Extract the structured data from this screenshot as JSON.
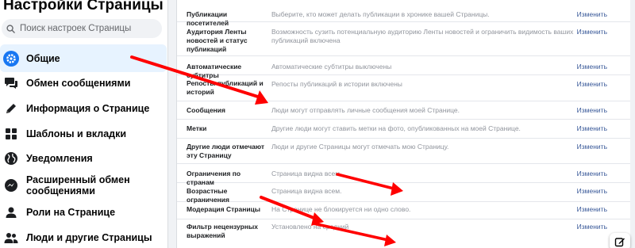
{
  "sidebar": {
    "title": "Настройки Страницы",
    "search_placeholder": "Поиск настроек Страницы",
    "items": [
      {
        "label": "Общие",
        "icon": "gear-icon",
        "active": true
      },
      {
        "label": "Обмен сообщениями",
        "icon": "chat-bubble-icon"
      },
      {
        "label": "Информация о Странице",
        "icon": "pencil-icon"
      },
      {
        "label": "Шаблоны и вкладки",
        "icon": "grid-icon"
      },
      {
        "label": "Уведомления",
        "icon": "globe-icon"
      },
      {
        "label": "Расширенный обмен сообщениями",
        "icon": "messenger-icon"
      },
      {
        "label": "Роли на Странице",
        "icon": "person-icon"
      },
      {
        "label": "Люди и другие Страницы",
        "icon": "people-icon"
      }
    ]
  },
  "settings": {
    "edit_label": "Изменить",
    "rows": [
      {
        "name": "Публикации посетителей",
        "desc": "Выберите, кто может делать публикации в хронике вашей Страницы."
      },
      {
        "name": "Аудитория Ленты новостей и статус публикаций",
        "desc": "Возможность сузить потенциальную аудиторию Ленты новостей и ограничить видимость ваших публикаций включена"
      },
      {
        "name": "Автоматические субтитры",
        "desc": "Автоматические субтитры выключены"
      },
      {
        "name": "Репосты публикаций и историй",
        "desc": "Репосты публикаций в истории включены"
      },
      {
        "name": "Сообщения",
        "desc": "Люди могут отправлять личные сообщения моей Странице."
      },
      {
        "name": "Метки",
        "desc": "Другие люди могут ставить метки на фото, опубликованных на моей Странице."
      },
      {
        "name": "Другие люди отмечают эту Страницу",
        "desc": "Люди и другие Страницы могут отмечать мою Страницу."
      },
      {
        "name": "Ограничения по странам",
        "desc": "Страница видна всем."
      },
      {
        "name": "Возрастные ограничения",
        "desc": "Страница видна всем."
      },
      {
        "name": "Модерация Страницы",
        "desc": "На Странице не блокируется ни одно слово."
      },
      {
        "name": "Фильтр нецензурных выражений",
        "desc": "Установлено на средний"
      }
    ]
  },
  "colors": {
    "accent": "#1877f2",
    "link": "#385898",
    "arrow": "#ff0000",
    "active_bg": "#e7f3ff"
  }
}
